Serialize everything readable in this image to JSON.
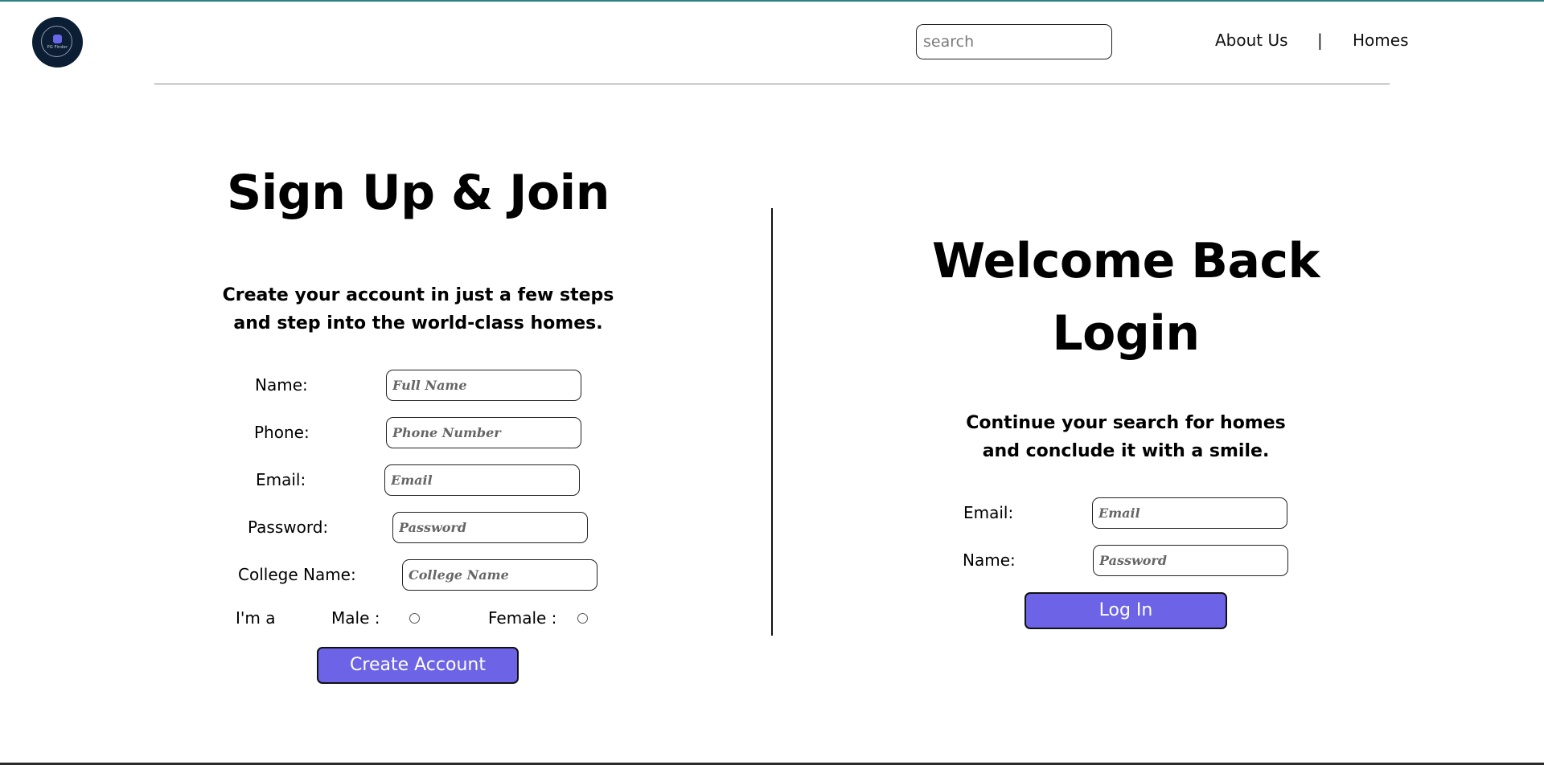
{
  "header": {
    "logo_text": "PG Finder",
    "search_placeholder": "search",
    "nav": {
      "about": "About Us",
      "separator": "|",
      "homes": "Homes"
    }
  },
  "signup": {
    "title": "Sign Up & Join",
    "subtitle_line1": "Create your account in just a few steps",
    "subtitle_line2": "and step into the world-class homes.",
    "fields": {
      "name": {
        "label": "Name:",
        "placeholder": "Full Name"
      },
      "phone": {
        "label": "Phone:",
        "placeholder": "Phone Number"
      },
      "email": {
        "label": "Email:",
        "placeholder": "Email"
      },
      "password": {
        "label": "Password:",
        "placeholder": "Password"
      },
      "college": {
        "label": "College Name:",
        "placeholder": "College Name"
      }
    },
    "gender": {
      "prefix": "I'm a",
      "male": "Male :",
      "female": "Female :"
    },
    "submit": "Create Account"
  },
  "login": {
    "title_line1": "Welcome Back",
    "title_line2": "Login",
    "subtitle_line1": "Continue your search for homes",
    "subtitle_line2": "and conclude it with a smile.",
    "fields": {
      "email": {
        "label": "Email:",
        "placeholder": "Email"
      },
      "password": {
        "label": "Name:",
        "placeholder": "Password"
      }
    },
    "submit": "Log In"
  },
  "colors": {
    "accent": "#6c63e6",
    "logo_bg": "#0b1e33",
    "top_border": "#2f7f87"
  }
}
